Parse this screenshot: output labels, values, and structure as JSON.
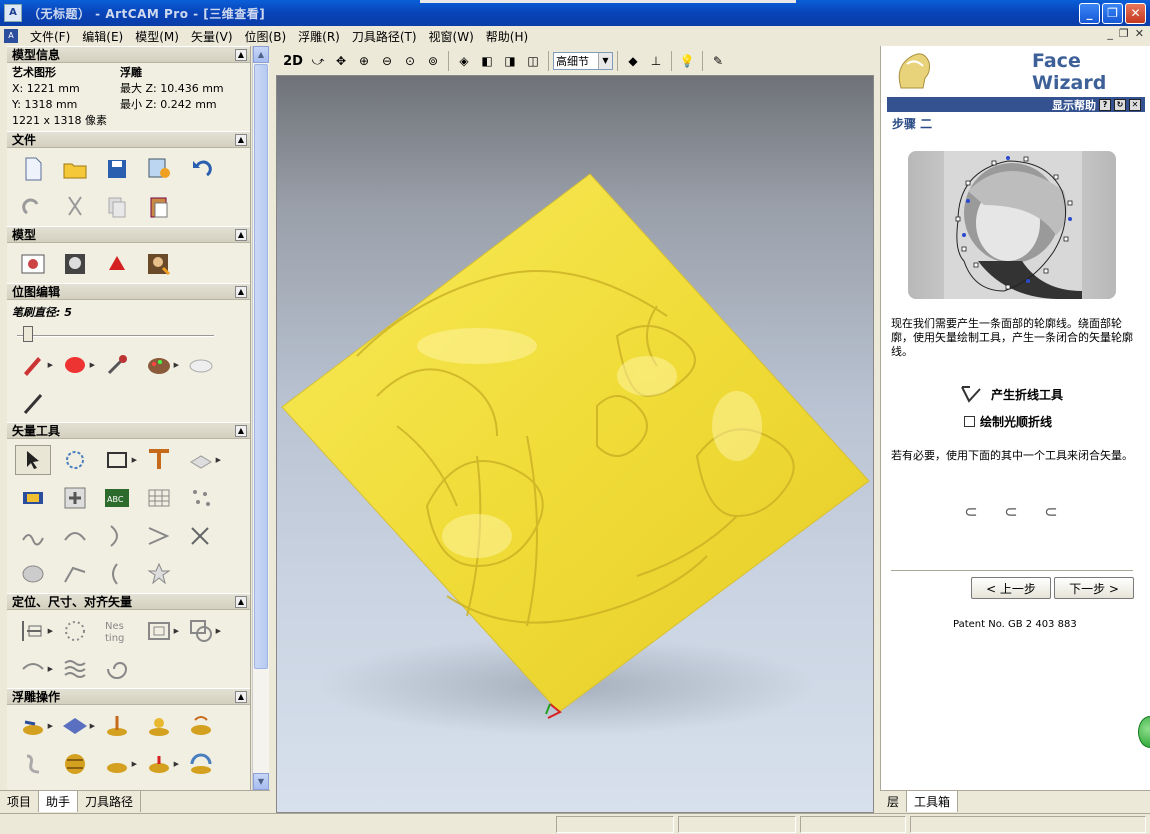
{
  "window": {
    "title": "（无标题） - ArtCAM Pro - [三维查看]",
    "icon_text": "A"
  },
  "menu": [
    "文件(F)",
    "编辑(E)",
    "模型(M)",
    "矢量(V)",
    "位图(B)",
    "浮雕(R)",
    "刀具路径(T)",
    "视窗(W)",
    "帮助(H)"
  ],
  "left": {
    "model_info": {
      "title": "模型信息",
      "art_label": "艺术图形",
      "relief_label": "浮雕",
      "x": "X: 1221 mm",
      "y": "Y: 1318 mm",
      "zmax": "最大  Z: 10.436 mm",
      "zmin": "最小  Z: 0.242 mm",
      "pixels": "1221 x 1318 像素"
    },
    "sections": {
      "file": "文件",
      "model": "模型",
      "bitmap": "位图编辑",
      "vector": "矢量工具",
      "position": "定位、尺寸、对齐矢量",
      "relief": "浮雕操作"
    },
    "brush_label": "笔刷直径:",
    "brush_value": "5"
  },
  "bottom_tabs": [
    "项目",
    "助手",
    "刀具路径"
  ],
  "viewtool": {
    "two_d": "2D",
    "detail": "高细节"
  },
  "wizard": {
    "title": "Face Wizard",
    "help": "显示帮助",
    "step": "步骤 二",
    "desc": "现在我们需要产生一条面部的轮廓线。绕面部轮廓，使用矢量绘制工具，产生一条闭合的矢量轮廓线。",
    "tool_label": "产生折线工具",
    "checkbox_label": "绘制光顺折线",
    "close_note": "若有必要，使用下面的其中一个工具来闭合矢量。",
    "prev": "< 上一步",
    "next": "下一步 >",
    "patent": "Patent No. GB 2 403 883"
  },
  "right_tabs": [
    "层",
    "工具箱"
  ],
  "colors": {
    "relief": "#f2df3a",
    "title_bar": "#0843b8",
    "wizard_blue": "#34528f"
  }
}
